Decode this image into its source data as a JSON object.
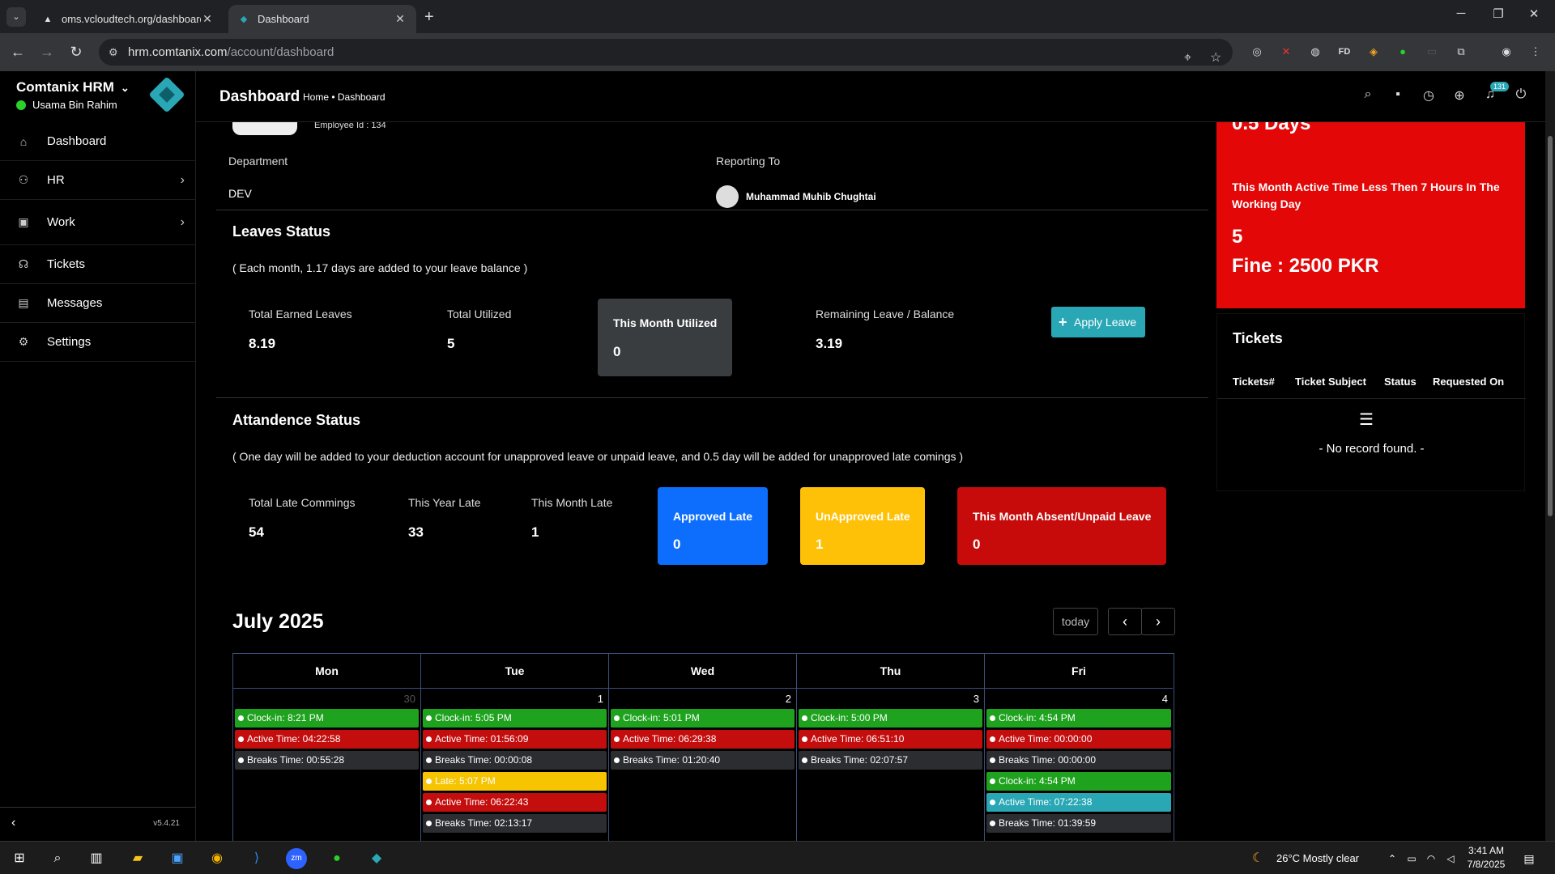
{
  "browser": {
    "tabs": [
      {
        "title": "oms.vcloudtech.org/dashboard",
        "active": false
      },
      {
        "title": "Dashboard",
        "active": true
      }
    ],
    "url_host": "hrm.comtanix.com",
    "url_path": "/account/dashboard"
  },
  "sidebar": {
    "brand": "Comtanix HRM",
    "user": "Usama Bin Rahim",
    "items": [
      {
        "label": "Dashboard",
        "icon": "home-icon"
      },
      {
        "label": "HR",
        "icon": "users-icon"
      },
      {
        "label": "Work",
        "icon": "briefcase-icon"
      },
      {
        "label": "Tickets",
        "icon": "headset-icon"
      },
      {
        "label": "Messages",
        "icon": "message-icon"
      },
      {
        "label": "Settings",
        "icon": "gear-icon"
      }
    ],
    "version": "v5.4.21"
  },
  "header": {
    "title": "Dashboard",
    "breadcrumb": "Home • Dashboard",
    "notification_count": "131"
  },
  "profile": {
    "employee_id": "Employee Id : 134",
    "department_label": "Department",
    "department": "DEV",
    "reporting_label": "Reporting To",
    "reporting_to": "Muhammad Muhib Chughtai"
  },
  "leaves": {
    "title": "Leaves Status",
    "note": "( Each month, 1.17 days are added to your leave balance )",
    "total_earned_label": "Total Earned Leaves",
    "total_earned": "8.19",
    "total_utilized_label": "Total Utilized",
    "total_utilized": "5",
    "month_utilized_label": "This Month Utilized",
    "month_utilized": "0",
    "remaining_label": "Remaining Leave / Balance",
    "remaining": "3.19",
    "apply_button": "Apply Leave"
  },
  "attendance": {
    "title": "Attandence Status",
    "note": "( One day will be added to your deduction account for unapproved leave or unpaid leave, and 0.5 day will be added for unapproved late comings )",
    "total_late_label": "Total Late Commings",
    "total_late": "54",
    "year_late_label": "This Year Late",
    "year_late": "33",
    "month_late_label": "This Month Late",
    "month_late": "1",
    "approved_late_label": "Approved Late",
    "approved_late": "0",
    "unapproved_late_label": "UnApproved Late",
    "unapproved_late": "1",
    "absent_label": "This Month Absent/Unpaid Leave",
    "absent": "0"
  },
  "calendar": {
    "title": "July 2025",
    "today_button": "today",
    "days": [
      {
        "name": "Mon",
        "num": "30",
        "events": [
          {
            "text": "Clock-in: 8:21 PM",
            "color": "green"
          },
          {
            "text": "Active Time: 04:22:58",
            "color": "red"
          },
          {
            "text": "Breaks Time: 00:55:28",
            "color": "dark"
          }
        ]
      },
      {
        "name": "Tue",
        "num": "1",
        "events": [
          {
            "text": "Clock-in: 5:05 PM",
            "color": "green"
          },
          {
            "text": "Active Time: 01:56:09",
            "color": "red"
          },
          {
            "text": "Breaks Time: 00:00:08",
            "color": "dark"
          },
          {
            "text": "Late: 5:07 PM",
            "color": "yellow"
          },
          {
            "text": "Active Time: 06:22:43",
            "color": "red"
          },
          {
            "text": "Breaks Time: 02:13:17",
            "color": "dark"
          }
        ]
      },
      {
        "name": "Wed",
        "num": "2",
        "events": [
          {
            "text": "Clock-in: 5:01 PM",
            "color": "green"
          },
          {
            "text": "Active Time: 06:29:38",
            "color": "red"
          },
          {
            "text": "Breaks Time: 01:20:40",
            "color": "dark"
          }
        ]
      },
      {
        "name": "Thu",
        "num": "3",
        "events": [
          {
            "text": "Clock-in: 5:00 PM",
            "color": "green"
          },
          {
            "text": "Active Time: 06:51:10",
            "color": "red"
          },
          {
            "text": "Breaks Time: 02:07:57",
            "color": "dark"
          }
        ]
      },
      {
        "name": "Fri",
        "num": "4",
        "events": [
          {
            "text": "Clock-in: 4:54 PM",
            "color": "green"
          },
          {
            "text": "Active Time: 00:00:00",
            "color": "red"
          },
          {
            "text": "Breaks Time: 00:00:00",
            "color": "dark"
          },
          {
            "text": "Clock-in: 4:54 PM",
            "color": "green"
          },
          {
            "text": "Active Time: 07:22:38",
            "color": "teal"
          },
          {
            "text": "Breaks Time: 01:39:59",
            "color": "dark"
          }
        ]
      }
    ]
  },
  "fine": {
    "days_partial": "0.5 Days",
    "message": "This Month Active Time Less Then 7 Hours In The Working Day",
    "count": "5",
    "fine": "Fine : 2500 PKR"
  },
  "tickets": {
    "title": "Tickets",
    "columns": [
      "Tickets#",
      "Ticket Subject",
      "Status",
      "Requested On"
    ],
    "empty": "- No record found. -"
  },
  "taskbar": {
    "weather": "26°C  Mostly clear",
    "time": "3:41 AM",
    "date": "7/8/2025"
  },
  "colors": {
    "accent": "#2aa7b5",
    "fine_red": "#e30707",
    "approved_blue": "#0d6efd",
    "unapproved_yellow": "#ffc107",
    "absent_red": "#c70b0b"
  }
}
